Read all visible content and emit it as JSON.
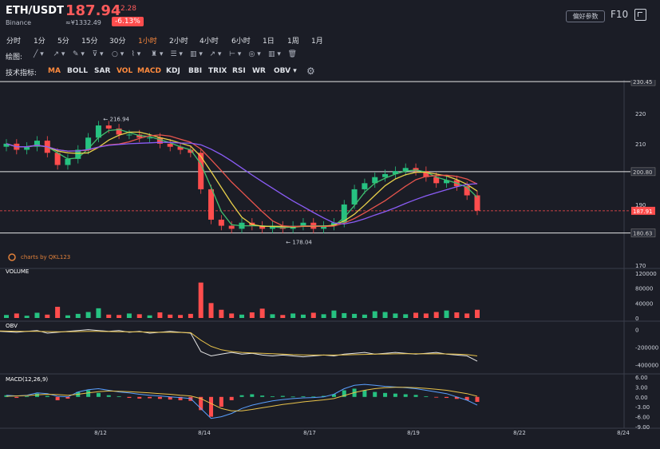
{
  "header": {
    "pair": "ETH/USDT",
    "exchange": "Binance",
    "price": "187.94",
    "cny": "≈¥1332.49",
    "change": "-12.28",
    "change_pct": "-6.13%",
    "settings_label": "偏好参数",
    "f10_label": "F10",
    "expand_icon": "expand-icon"
  },
  "timeframes": [
    "分时",
    "1分",
    "5分",
    "15分",
    "30分",
    "1小时",
    "2小时",
    "4小时",
    "6小时",
    "1日",
    "1周",
    "1月"
  ],
  "active_timeframe": "1小时",
  "drawing": {
    "label": "绘图:",
    "tools": [
      "line-tool",
      "ray-tool",
      "pen-tool",
      "shape-tool",
      "circle-tool",
      "brush-tool",
      "pitchfork-tool",
      "fib-tool",
      "gann-tool",
      "arrow-tool",
      "measure-tool",
      "eye-tool",
      "text-tool",
      "delete-tool"
    ]
  },
  "indicators": {
    "label": "技术指标:",
    "items": [
      "MA",
      "BOLL",
      "SAR",
      "VOL",
      "MACD",
      "KDJ",
      "BBI",
      "TRIX",
      "RSI",
      "WR",
      "OBV ▾"
    ],
    "active": [
      "MA",
      "VOL",
      "MACD"
    ]
  },
  "watermark": "charts by QKL123",
  "chart_data": [
    {
      "type": "candlestick",
      "pane": "price",
      "ylim": [
        170,
        231
      ],
      "y_ticks": [
        "230.45",
        "220",
        "210",
        "200.80",
        "190",
        "187.91",
        "180.63",
        "170"
      ],
      "hlines": [
        230.45,
        200.8,
        180.63
      ],
      "current_price": "187.91",
      "annotations": [
        {
          "label": "216.94",
          "x": "8/12"
        },
        {
          "label": "178.04",
          "x": "8/15"
        }
      ],
      "x_ticks": [
        "8/12",
        "8/14",
        "8/17",
        "8/19",
        "8/22",
        "8/24"
      ],
      "series": [
        {
          "name": "close",
          "values": [
            210,
            208,
            209,
            211,
            207,
            203,
            205,
            208,
            212,
            216,
            215,
            213,
            213,
            212,
            212,
            210,
            209,
            208,
            207,
            195,
            185,
            183,
            182,
            184,
            183,
            182,
            183,
            182,
            183,
            184,
            182,
            183,
            184,
            190,
            195,
            197,
            199,
            200,
            201,
            202,
            201,
            199,
            197,
            198,
            196,
            193,
            188
          ]
        }
      ],
      "colors": {
        "up": "#26c281",
        "down": "#ff4d4d",
        "ma_purple": "#8a5cf6",
        "ma_red": "#e8544d",
        "ma_yellow": "#e8d04a",
        "ma_green": "#3fbf6e"
      }
    },
    {
      "type": "bar",
      "pane": "volume",
      "title": "VOLUME",
      "y_ticks": [
        "120000",
        "80000",
        "40000",
        "0"
      ],
      "ylim": [
        0,
        120000
      ],
      "values": [
        8000,
        12000,
        6000,
        14000,
        9000,
        30000,
        7000,
        11000,
        16000,
        26000,
        9000,
        8000,
        12000,
        10000,
        7000,
        15000,
        9000,
        8000,
        11000,
        95000,
        40000,
        22000,
        12000,
        9000,
        15000,
        25000,
        10000,
        8000,
        12000,
        9000,
        14000,
        10000,
        20000,
        13000,
        11000,
        9000,
        18000,
        16000,
        12000,
        10000,
        14000,
        12000,
        16000,
        20000,
        15000,
        12000,
        22000
      ]
    },
    {
      "type": "line",
      "pane": "obv",
      "title": "OBV",
      "y_ticks": [
        "0",
        "-200000",
        "-400000"
      ],
      "ylim": [
        -450000,
        60000
      ],
      "series": [
        {
          "values": [
            -20000,
            -30000,
            -20000,
            -10000,
            -40000,
            -30000,
            -20000,
            -10000,
            0,
            -10000,
            -20000,
            -10000,
            -30000,
            -20000,
            -40000,
            -30000,
            -20000,
            -30000,
            -40000,
            -250000,
            -300000,
            -280000,
            -260000,
            -280000,
            -270000,
            -290000,
            -300000,
            -290000,
            -300000,
            -310000,
            -300000,
            -290000,
            -300000,
            -280000,
            -270000,
            -260000,
            -280000,
            -270000,
            -260000,
            -270000,
            -280000,
            -270000,
            -260000,
            -280000,
            -290000,
            -300000,
            -360000
          ]
        },
        {
          "values": [
            -15000,
            -18000,
            -20000,
            -20000,
            -22000,
            -24000,
            -25000,
            -22000,
            -20000,
            -20000,
            -22000,
            -24000,
            -25000,
            -26000,
            -28000,
            -30000,
            -30000,
            -32000,
            -35000,
            -120000,
            -190000,
            -230000,
            -250000,
            -260000,
            -265000,
            -270000,
            -275000,
            -280000,
            -285000,
            -288000,
            -290000,
            -290000,
            -290000,
            -288000,
            -285000,
            -282000,
            -280000,
            -278000,
            -276000,
            -275000,
            -275000,
            -276000,
            -275000,
            -277000,
            -280000,
            -285000,
            -300000
          ]
        }
      ],
      "colors": [
        "#e6e6e6",
        "#e8c24a"
      ]
    },
    {
      "type": "bar",
      "pane": "macd",
      "title": "MACD(12,26,9)",
      "y_ticks": [
        "6.00",
        "3.00",
        "0.00",
        "-3.00",
        "-6.00",
        "-9.00"
      ],
      "ylim": [
        -9,
        6
      ],
      "values": [
        0.5,
        -0.3,
        0.2,
        1.0,
        0.3,
        -1.0,
        -0.5,
        1.5,
        2.0,
        1.2,
        0.5,
        0.2,
        -0.3,
        -0.5,
        -0.4,
        -0.6,
        -0.8,
        -1.0,
        -1.2,
        -4.0,
        -6.0,
        -3.0,
        -1.0,
        0.5,
        0.8,
        0.4,
        0.2,
        0.3,
        0.1,
        0.2,
        0.1,
        0.3,
        0.8,
        2.0,
        2.5,
        2.0,
        1.5,
        1.2,
        1.0,
        0.8,
        0.6,
        0.2,
        -0.2,
        -0.3,
        -0.6,
        -1.0,
        -1.5
      ],
      "dif": [
        0.5,
        0.3,
        0.5,
        1.2,
        1.0,
        0.2,
        0.0,
        1.5,
        2.2,
        2.5,
        2.0,
        1.5,
        1.2,
        0.8,
        0.5,
        0.3,
        0.0,
        -0.2,
        -0.5,
        -3.5,
        -6.5,
        -6.0,
        -5.0,
        -3.5,
        -2.5,
        -1.8,
        -1.2,
        -0.8,
        -0.5,
        -0.3,
        -0.2,
        0.0,
        0.8,
        2.5,
        3.5,
        3.8,
        3.5,
        3.2,
        3.0,
        2.8,
        2.5,
        2.0,
        1.5,
        1.0,
        0.0,
        -1.0,
        -2.5
      ],
      "dea": [
        0.2,
        0.3,
        0.4,
        0.6,
        0.8,
        0.7,
        0.5,
        0.8,
        1.2,
        1.6,
        1.8,
        1.7,
        1.6,
        1.4,
        1.2,
        1.0,
        0.8,
        0.5,
        0.3,
        -0.5,
        -2.0,
        -3.5,
        -4.2,
        -4.2,
        -3.8,
        -3.3,
        -2.8,
        -2.3,
        -1.9,
        -1.5,
        -1.2,
        -0.9,
        -0.5,
        0.4,
        1.3,
        2.0,
        2.5,
        2.8,
        2.9,
        2.9,
        2.8,
        2.6,
        2.3,
        2.0,
        1.5,
        1.0,
        0.2
      ]
    }
  ]
}
